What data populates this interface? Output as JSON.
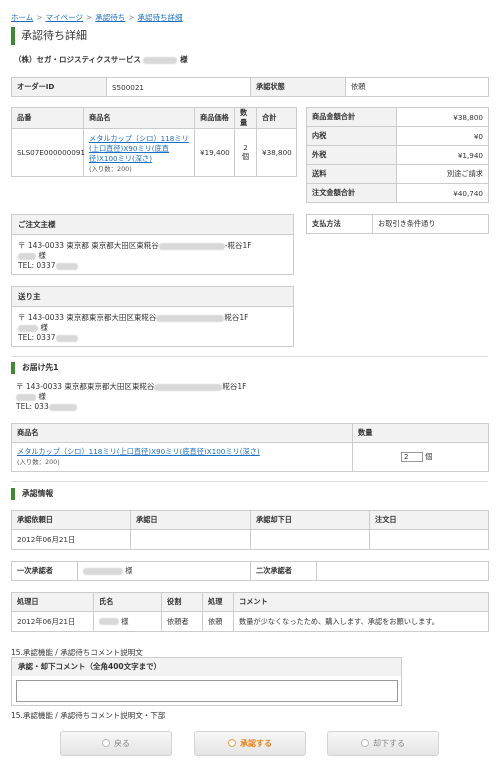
{
  "breadcrumb": {
    "home": "ホーム",
    "sep": ">",
    "mypage": "マイページ",
    "pending": "承認待ち",
    "detail": "承認待ち詳細"
  },
  "page_title": "承認待ち詳細",
  "company": {
    "name": "（株）セガ・ロジスティクスサービス",
    "suffix": "様"
  },
  "order": {
    "id_label": "オーダーID",
    "id_value": "S500021",
    "status_label": "承認状態",
    "status_value": "依頼"
  },
  "items_table": {
    "headers": [
      "品番",
      "商品名",
      "商品価格",
      "数量",
      "合計"
    ],
    "row": {
      "code": "SLS07E000000091",
      "name": "メタルカップ（シロ）118ミリ(上口直径)X90ミリ(底直径)X100ミリ(深さ)",
      "note": "(入り数：200)",
      "price": "¥19,400",
      "qty": "2 個",
      "total": "¥38,800"
    }
  },
  "summary": {
    "rows": [
      {
        "label": "商品金額合計",
        "value": "¥38,800"
      },
      {
        "label": "内税",
        "value": "¥0"
      },
      {
        "label": "外税",
        "value": "¥1,940"
      },
      {
        "label": "送料",
        "value": "別途ご請求"
      },
      {
        "label": "注文金額合計",
        "value": "¥40,740"
      }
    ]
  },
  "payment": {
    "label": "支払方法",
    "value": "お取引き条件通り"
  },
  "orderer": {
    "title": "ご注文主様",
    "address": "〒 143-0033 東京都 東京都大田区東糀谷",
    "address_tail": "-糀谷1F",
    "name_suffix": "様",
    "tel": "TEL: 0337"
  },
  "sender": {
    "title": "送り主",
    "address": "〒 143-0033 東京都東京都大田区東糀谷",
    "address_tail": "糀谷1F",
    "name_suffix": "様",
    "tel": "TEL: 0337"
  },
  "delivery": {
    "title": "お届け先1",
    "address": "〒 143-0033 東京都東京都大田区東糀谷",
    "address_tail": "糀谷1F",
    "name_suffix": "様",
    "tel": "TEL: 033",
    "headers": [
      "商品名",
      "数量"
    ],
    "item_name": "メタルカップ（シロ）118ミリ(上口直径)X90ミリ(底直径)X100ミリ(深さ)",
    "item_note": "(入り数：200)",
    "qty_value": "2",
    "qty_unit": "個"
  },
  "approval": {
    "title": "承認情報",
    "headers": [
      "承認依頼日",
      "承認日",
      "承認却下日",
      "注文日"
    ],
    "request_date": "2012年06月21日",
    "first_label": "一次承認者",
    "first_suffix": "様",
    "second_label": "二次承認者",
    "history_headers": [
      "処理日",
      "氏名",
      "役割",
      "処理",
      "コメント"
    ],
    "history": {
      "date": "2012年06月21日",
      "name_suffix": "様",
      "role": "依頼者",
      "action": "依頼",
      "comment": "数量が少なくなったため、購入します、承認をお願いします。"
    }
  },
  "comment": {
    "desc_top": "15.承認機能 / 承認待ちコメント説明文",
    "label": "承認・却下コメント（全角400文字まで）",
    "value": "",
    "desc_bottom": "15.承認機能 / 承認待ちコメント説明文・下部"
  },
  "buttons": {
    "back": "戻る",
    "approve": "承認する",
    "reject": "却下する"
  },
  "colors": {
    "accent_green": "#3a8c2e",
    "link_blue": "#1a6fc4",
    "approve_orange": "#e8841a"
  }
}
